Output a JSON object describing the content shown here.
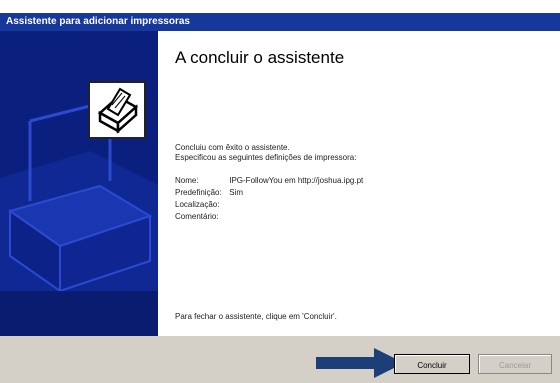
{
  "window": {
    "title": "Assistente para adicionar impressoras"
  },
  "wizard": {
    "heading": "A concluir o assistente",
    "intro_line1": "Concluiu com êxito o assistente.",
    "intro_line2": "Especificou as seguintes definições de impressora:",
    "fields": [
      {
        "label": "Nome:",
        "value": "IPG-FollowYou em http://joshua.ipg.pt"
      },
      {
        "label": "Predefinição:",
        "value": "Sim"
      },
      {
        "label": "Localização:",
        "value": ""
      },
      {
        "label": "Comentário:",
        "value": ""
      }
    ],
    "closing": "Para fechar o assistente, clique em 'Concluir'."
  },
  "buttons": {
    "finish": "Concluir",
    "cancel": "Cancelar"
  },
  "colors": {
    "title_bar": "#16389a",
    "side_panel": "#0b1f7e",
    "footer": "#d4d0c8",
    "arrow": "#1c3f7a"
  }
}
